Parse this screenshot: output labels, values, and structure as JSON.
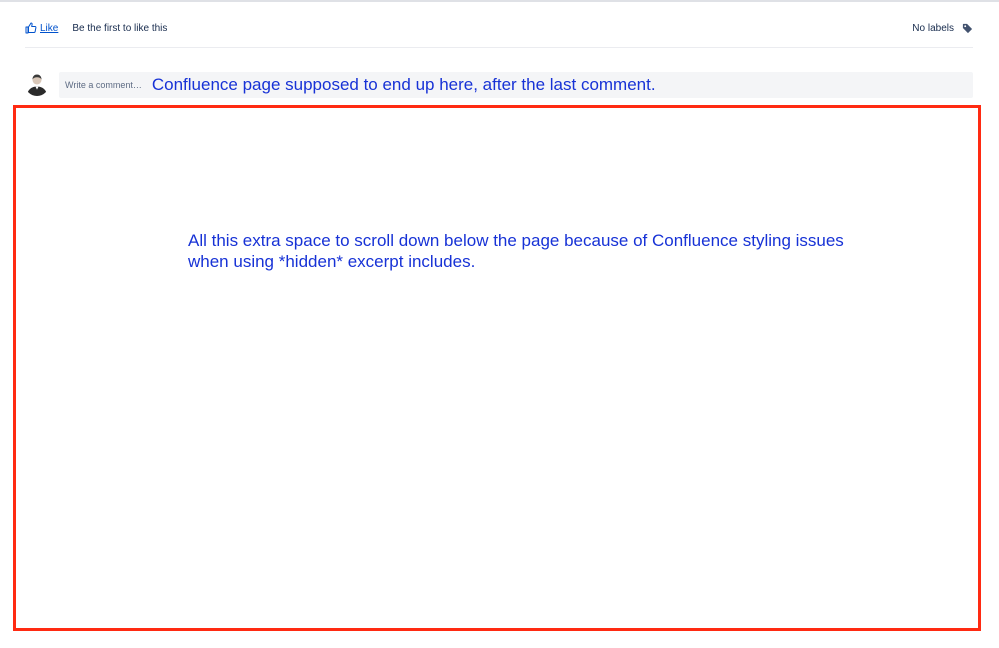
{
  "footer": {
    "like_label": "Like",
    "like_summary": "Be the first to like this",
    "labels_text": "No labels"
  },
  "comment": {
    "placeholder": "Write a comment…"
  },
  "annotations": {
    "top_note": "Confluence page supposed to end up here, after the last comment.",
    "center_note": "All this extra space to scroll down below the page because of Confluence styling issues when using *hidden* excerpt includes.",
    "highlight_color": "#ff2a12",
    "text_color": "#1732d6"
  }
}
